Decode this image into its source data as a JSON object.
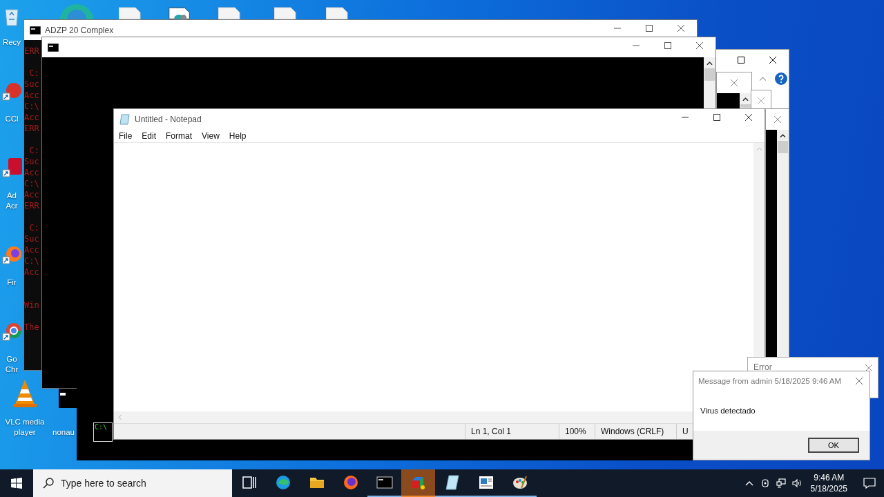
{
  "desktop": {
    "icons": [
      {
        "kind": "recycle",
        "lines": [
          "Recy"
        ]
      },
      {
        "kind": "ccleaner",
        "lines": [
          "CCl"
        ]
      },
      {
        "kind": "acrobat",
        "lines": [
          "Ad",
          "Acr"
        ]
      },
      {
        "kind": "firefox",
        "lines": [
          "Fir"
        ]
      },
      {
        "kind": "chrome",
        "lines": [
          "Go",
          "Chr"
        ]
      },
      {
        "kind": "vlc",
        "lines": [
          "VLC media",
          "player"
        ]
      },
      {
        "kind": "console",
        "lines": [
          "nonau"
        ]
      }
    ]
  },
  "console_windows": [
    {
      "title": "ADZP 20 Complex",
      "groups": [
        [
          "ERR"
        ],
        [
          " C:",
          "Suc",
          "Acc",
          "C:\\",
          "Acc",
          "ERR"
        ],
        [
          " C:",
          "Suc",
          "Acc",
          "C:\\",
          "Acc",
          "ERR"
        ],
        [
          " C:",
          "Suc",
          "Acc",
          "C:\\",
          "Acc"
        ],
        [
          "Win"
        ],
        [
          "The"
        ]
      ]
    }
  ],
  "small_console": {
    "lines": [
      "C:\\"
    ]
  },
  "notepad": {
    "title": "Untitled - Notepad",
    "menu": [
      "File",
      "Edit",
      "Format",
      "View",
      "Help"
    ],
    "status": [
      "Ln 1, Col 1",
      "100%",
      "Windows (CRLF)",
      "U"
    ]
  },
  "error_window": {
    "title": "Error"
  },
  "message_box": {
    "title": "Message from admin 5/18/2025 9:46 AM",
    "text": "Virus detectado",
    "button": "OK"
  },
  "taskbar": {
    "search_placeholder": "Type here to search",
    "apps": [
      {
        "kind": "task-view",
        "running": false,
        "selected": false
      },
      {
        "kind": "edge",
        "running": false,
        "selected": false
      },
      {
        "kind": "folder",
        "running": false,
        "selected": false
      },
      {
        "kind": "firefox",
        "running": false,
        "selected": false
      },
      {
        "kind": "console",
        "running": true,
        "selected": false
      },
      {
        "kind": "cube",
        "running": true,
        "selected": true
      },
      {
        "kind": "notepad",
        "running": true,
        "selected": false
      },
      {
        "kind": "form",
        "running": true,
        "selected": false
      },
      {
        "kind": "palette",
        "running": true,
        "selected": false
      }
    ],
    "time": "9:46 AM",
    "date": "5/18/2025"
  }
}
